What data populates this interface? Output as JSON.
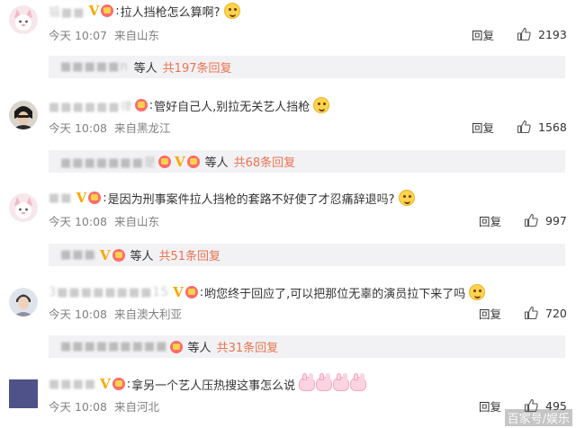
{
  "colors": {
    "link": "#eb7350",
    "meta": "#808080",
    "sub_bg": "#f2f2f5",
    "vip": "#f7a800"
  },
  "comments": [
    {
      "username": "猫■■",
      "text": "拉人挡枪怎么算啊?",
      "time": "今天 10:07",
      "location": "来自山东",
      "reply_label": "回复",
      "likes": "2193",
      "sub": {
        "username": "■■■■■n",
        "people": "等人",
        "total": "共197条回复"
      }
    },
    {
      "username": "■■■■■■律",
      "text": "管好自己人,别拉无关艺人挡枪",
      "time": "今天 10:08",
      "location": "来自黑龙江",
      "reply_label": "回复",
      "likes": "1568",
      "sub": {
        "username": "■■■■■■■是",
        "people": "等人",
        "total": "共68条回复"
      }
    },
    {
      "username": "■■",
      "text": "是因为刑事案件拉人挡枪的套路不好使了才忍痛辞退吗?",
      "time": "今天 10:08",
      "location": "来自山东",
      "reply_label": "回复",
      "likes": "997",
      "sub": {
        "username": "■■■",
        "people": "等人",
        "total": "共51条回复"
      }
    },
    {
      "username": "3■■■■■■■■15",
      "text": "哟您终于回应了,可以把那位无辜的演员拉下来了吗",
      "time": "今天 10:08",
      "location": "来自澳大利亚",
      "reply_label": "回复",
      "likes": "720",
      "sub": {
        "username": "■■■■■■■■■",
        "people": "等人",
        "total": "共31条回复"
      }
    },
    {
      "username": "■■■■",
      "text": "拿另一个艺人压热搜这事怎么说",
      "time": "今天 10:08",
      "location": "来自河北",
      "reply_label": "回复",
      "likes": "495"
    }
  ],
  "watermark": "百家号/娱乐"
}
